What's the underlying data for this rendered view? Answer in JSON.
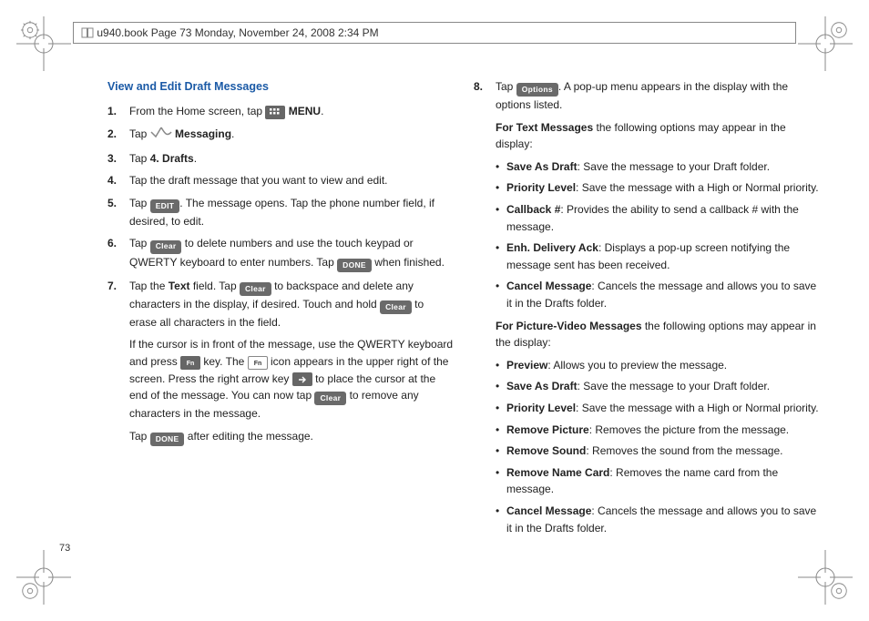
{
  "header": {
    "stamp": "u940.book  Page 73  Monday, November 24, 2008  2:34 PM"
  },
  "page_number": "73",
  "left": {
    "heading": "View and Edit Draft Messages",
    "s1_a": "From the Home screen, tap ",
    "s1_b": " MENU",
    "s1_c": ".",
    "s2_a": "Tap ",
    "s2_b": " Messaging",
    "s2_c": ".",
    "s3_a": "Tap ",
    "s3_b": "4. Drafts",
    "s3_c": ".",
    "s4": "Tap the draft message that you want to view and edit.",
    "s5_a": "Tap ",
    "s5_b": ". The message opens. Tap the phone number field, if desired, to edit.",
    "s6_a": "Tap ",
    "s6_b": " to delete numbers and use the touch keypad or QWERTY keyboard to enter numbers. Tap ",
    "s6_c": " when finished.",
    "s7_a": "Tap the ",
    "s7_b": "Text",
    "s7_c": " field. Tap ",
    "s7_d": " to backspace and delete any characters in the display, if desired. Touch and hold ",
    "s7_e": " to erase all characters in the field.",
    "s7_p2_a": "If the cursor is in front of the message, use the QWERTY keyboard and press ",
    "s7_p2_b": " key. The ",
    "s7_p2_c": " icon appears in the upper right of the screen. Press the right arrow key ",
    "s7_p2_d": " to place the cursor at the end of the message. You can now tap ",
    "s7_p2_e": " to remove any characters in the message.",
    "s7_p3_a": "Tap ",
    "s7_p3_b": " after editing the message.",
    "btn_edit": "EDIT",
    "btn_clear": "Clear",
    "btn_done": "DONE",
    "btn_options": "Options",
    "menu_label": "MENU"
  },
  "right": {
    "s8_a": "Tap ",
    "s8_b": ". A pop-up menu appears in the display with the options listed.",
    "txt_hdr_a": "For Text Messages",
    "txt_hdr_b": " the following options may appear in the display:",
    "txt_opts": [
      {
        "t": "Save As Draft",
        "d": ": Save the message to your Draft folder."
      },
      {
        "t": "Priority Level",
        "d": ": Save the message with a High or Normal priority."
      },
      {
        "t": "Callback #",
        "d": ": Provides the ability to send a callback # with the message."
      },
      {
        "t": "Enh. Delivery Ack",
        "d": ": Displays a pop-up screen notifying the message sent has been received."
      },
      {
        "t": "Cancel Message",
        "d": ": Cancels the message and allows you to save it in the Drafts folder."
      }
    ],
    "pv_hdr_a": "For Picture-Video Messages",
    "pv_hdr_b": " the following options may appear in the display:",
    "pv_opts": [
      {
        "t": "Preview",
        "d": ": Allows you to preview the message."
      },
      {
        "t": "Save As Draft",
        "d": ": Save the message to your Draft folder."
      },
      {
        "t": "Priority Level",
        "d": ": Save the message with a High or Normal priority."
      },
      {
        "t": "Remove Picture",
        "d": ": Removes the picture from the message."
      },
      {
        "t": "Remove Sound",
        "d": ": Removes the sound from the message."
      },
      {
        "t": "Remove Name Card",
        "d": ": Removes the name card from the message."
      },
      {
        "t": "Cancel Message",
        "d": ": Cancels the message and allows you to save it in the Drafts folder."
      }
    ]
  }
}
